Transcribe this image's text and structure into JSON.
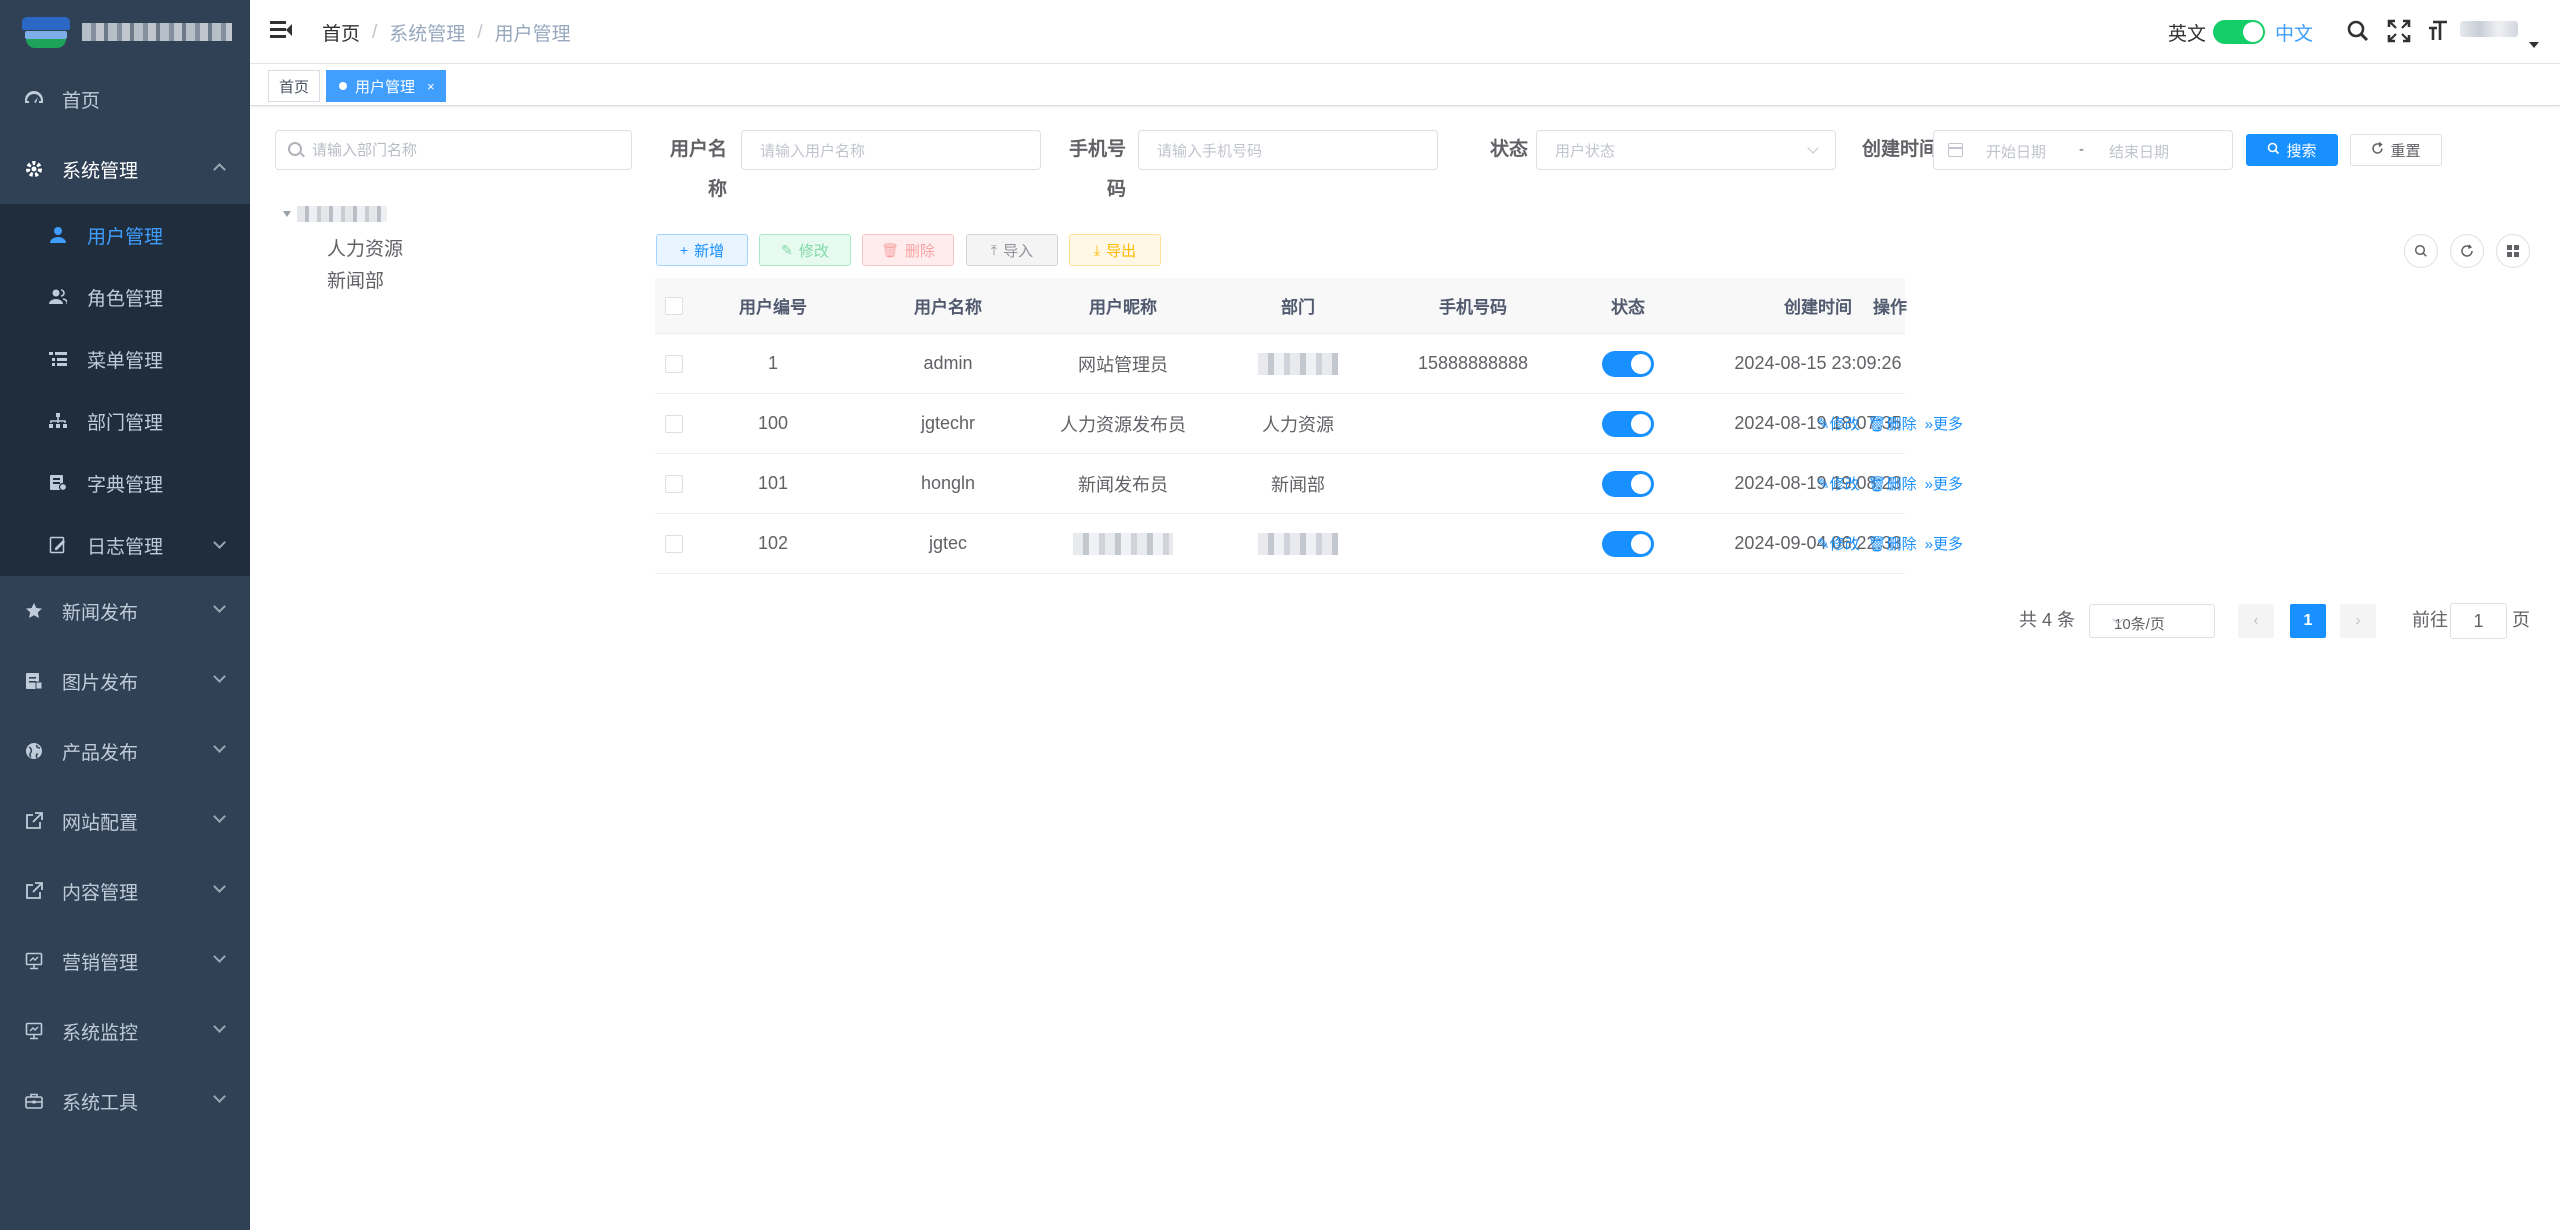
{
  "sidebar": {
    "menu": [
      {
        "label": "首页",
        "icon": "dashboard-icon"
      },
      {
        "label": "系统管理",
        "icon": "gear-icon",
        "open": true,
        "children": [
          {
            "label": "用户管理",
            "icon": "user-icon",
            "active": true
          },
          {
            "label": "角色管理",
            "icon": "peoples-icon"
          },
          {
            "label": "菜单管理",
            "icon": "tree-table-icon"
          },
          {
            "label": "部门管理",
            "icon": "tree-icon"
          },
          {
            "label": "字典管理",
            "icon": "dict-icon"
          },
          {
            "label": "日志管理",
            "icon": "log-icon"
          }
        ]
      },
      {
        "label": "新闻发布",
        "icon": "star-icon"
      },
      {
        "label": "图片发布",
        "icon": "document-icon"
      },
      {
        "label": "产品发布",
        "icon": "globe-icon"
      },
      {
        "label": "网站配置",
        "icon": "external-link-icon"
      },
      {
        "label": "内容管理",
        "icon": "external-link-icon"
      },
      {
        "label": "营销管理",
        "icon": "monitor-icon"
      },
      {
        "label": "系统监控",
        "icon": "monitor-icon"
      },
      {
        "label": "系统工具",
        "icon": "toolbox-icon"
      }
    ]
  },
  "navbar": {
    "breadcrumb": [
      "首页",
      "系统管理",
      "用户管理"
    ],
    "lang_en": "英文",
    "lang_zh": "中文"
  },
  "tags": {
    "home": "首页",
    "active": "用户管理",
    "close": "×"
  },
  "dept": {
    "search_placeholder": "请输入部门名称",
    "tree_children": [
      "人力资源",
      "新闻部"
    ]
  },
  "filters": {
    "username_label": "用户名称",
    "username_placeholder": "请输入用户名称",
    "phone_label": "手机号码",
    "phone_placeholder": "请输入手机号码",
    "status_label": "状态",
    "status_placeholder": "用户状态",
    "created_label": "创建时间",
    "date_start": "开始日期",
    "date_sep": "-",
    "date_end": "结束日期",
    "search_btn": "搜索",
    "reset_btn": "重置"
  },
  "toolbar": {
    "add": "新增",
    "edit": "修改",
    "delete": "删除",
    "import": "导入",
    "export": "导出"
  },
  "table": {
    "columns": [
      "用户编号",
      "用户名称",
      "用户昵称",
      "部门",
      "手机号码",
      "状态",
      "创建时间",
      "操作"
    ],
    "rows": [
      {
        "id": "1",
        "username": "admin",
        "nickname": "网站管理员",
        "dept": "",
        "phone": "15888888888",
        "status": true,
        "created": "2024-08-15 23:09:26",
        "ops": false
      },
      {
        "id": "100",
        "username": "jgtechr",
        "nickname": "人力资源发布员",
        "dept": "人力资源",
        "phone": "",
        "status": true,
        "created": "2024-08-19 18:07:35",
        "ops": true
      },
      {
        "id": "101",
        "username": "hongln",
        "nickname": "新闻发布员",
        "dept": "新闻部",
        "phone": "",
        "status": true,
        "created": "2024-08-19 19:08:23",
        "ops": true
      },
      {
        "id": "102",
        "username": "jgtec",
        "nickname": "",
        "dept": "",
        "phone": "",
        "status": true,
        "created": "2024-09-04 06:22:33",
        "ops": true
      }
    ],
    "op_edit": "修改",
    "op_delete": "删除",
    "op_more": "更多"
  },
  "pagination": {
    "total": "共 4 条",
    "page_size": "10条/页",
    "current": "1",
    "goto_prefix": "前往",
    "goto_value": "1",
    "goto_suffix": "页"
  },
  "colors": {
    "sidebar_bg": "#304156",
    "submenu_bg": "#1f2d3d",
    "primary": "#1890ff",
    "switch_on": "#13ce66"
  }
}
